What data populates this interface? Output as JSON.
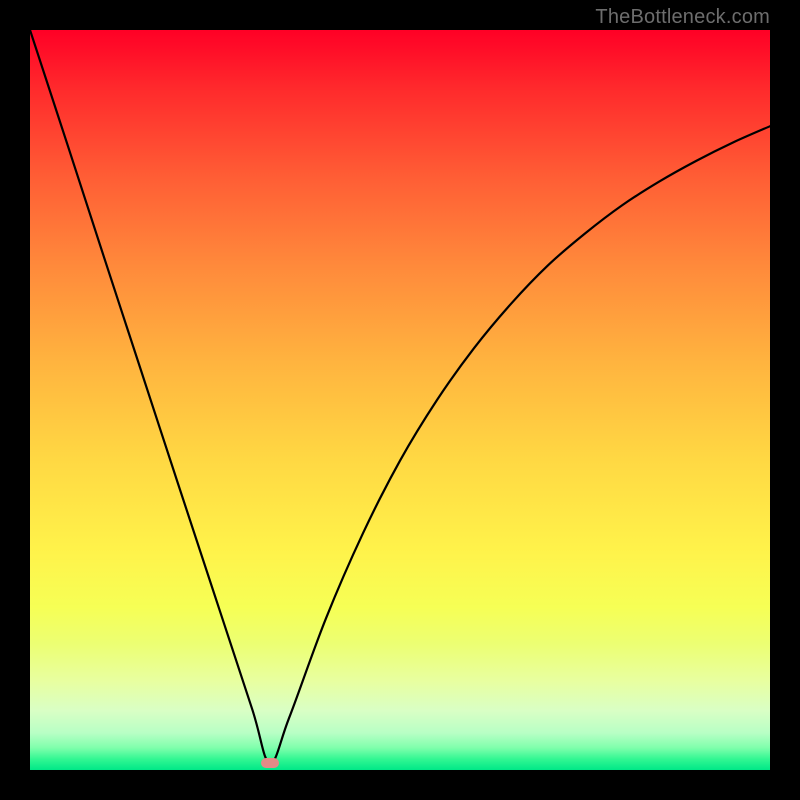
{
  "watermark": "TheBottleneck.com",
  "chart_data": {
    "type": "line",
    "title": "",
    "xlabel": "",
    "ylabel": "",
    "xlim": [
      0,
      1
    ],
    "ylim": [
      0,
      1
    ],
    "series": [
      {
        "name": "curve",
        "x": [
          0.0,
          0.05,
          0.1,
          0.15,
          0.2,
          0.25,
          0.3,
          0.324,
          0.35,
          0.4,
          0.45,
          0.5,
          0.55,
          0.6,
          0.65,
          0.7,
          0.75,
          0.8,
          0.85,
          0.9,
          0.95,
          1.0
        ],
        "y": [
          1.0,
          0.847,
          0.693,
          0.54,
          0.387,
          0.235,
          0.083,
          0.01,
          0.07,
          0.205,
          0.32,
          0.418,
          0.5,
          0.57,
          0.63,
          0.682,
          0.725,
          0.763,
          0.795,
          0.823,
          0.848,
          0.87
        ]
      }
    ],
    "marker": {
      "x": 0.324,
      "y": 0.01
    },
    "background_gradient": {
      "top": "#ff0026",
      "bottom": "#00e888"
    }
  }
}
